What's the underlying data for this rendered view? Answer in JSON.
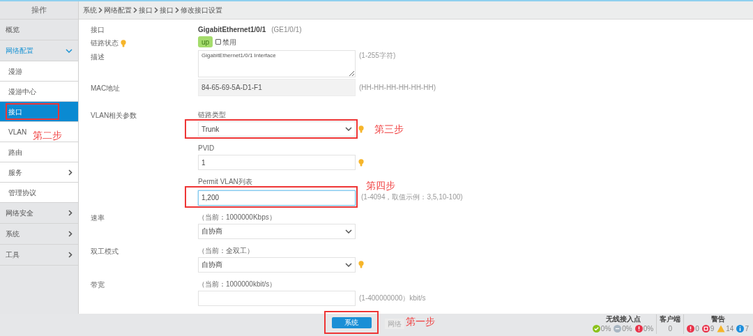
{
  "sidebar": {
    "header": "操作",
    "items": [
      {
        "label": "概览",
        "kind": "top",
        "expanded": false,
        "selected": false
      },
      {
        "label": "网络配置",
        "kind": "parent",
        "expanded": true,
        "selected": false,
        "children": [
          {
            "label": "漫游",
            "selected": false
          },
          {
            "label": "漫游中心",
            "selected": false
          },
          {
            "label": "接口",
            "selected": true,
            "annotation": "第二步"
          },
          {
            "label": "VLAN",
            "selected": false
          },
          {
            "label": "路由",
            "selected": false
          },
          {
            "label": "服务",
            "selected": false,
            "has_submenu": true
          },
          {
            "label": "管理协议",
            "selected": false
          }
        ]
      },
      {
        "label": "网络安全",
        "kind": "parent",
        "expanded": false,
        "selected": false
      },
      {
        "label": "系统",
        "kind": "parent",
        "expanded": false,
        "selected": false
      },
      {
        "label": "工具",
        "kind": "parent",
        "expanded": false,
        "selected": false
      }
    ]
  },
  "breadcrumb": [
    "系统",
    "网络配置",
    "接口",
    "接口",
    "修改接口设置"
  ],
  "form": [
    {
      "label": "接口",
      "kind": "text",
      "value": "GigabitEthernet1/0/1",
      "note": "(GE1/0/1)"
    },
    {
      "label": "链路状态",
      "kind": "status",
      "tip": true,
      "badge": "up",
      "checkbox": {
        "label": "禁用",
        "checked": false
      }
    },
    {
      "label": "描述",
      "kind": "textarea",
      "value": "GigabitEthernet1/0/1 Interface",
      "note": "(1-255字符)"
    },
    {
      "label": "MAC地址",
      "kind": "readonly",
      "value": "84-65-69-5A-D1-F1",
      "note": "(HH-HH-HH-HH-HH-HH)"
    },
    {
      "label": "VLAN相关参数",
      "kind": "group",
      "items": [
        {
          "caption": "链路类型",
          "kind": "select",
          "value": "Trunk",
          "tip": true,
          "annotation": "第三步"
        },
        {
          "caption": "PVID",
          "kind": "input",
          "value": "1",
          "tip": true
        },
        {
          "caption": "Permit VLAN列表",
          "kind": "input",
          "value": "1,200",
          "focused": true,
          "note": "(1-4094，取值示例：3,5,10-100)",
          "annotation": "第四步"
        }
      ]
    },
    {
      "label": "速率",
      "kind": "group",
      "items": [
        {
          "caption": "（当前：1000000Kbps）",
          "kind": "select",
          "value": "自协商"
        }
      ]
    },
    {
      "label": "双工模式",
      "kind": "group",
      "items": [
        {
          "caption": "（当前：全双工）",
          "kind": "select",
          "value": "自协商",
          "tip": true
        }
      ]
    },
    {
      "label": "带宽",
      "kind": "group",
      "items": [
        {
          "caption": "（当前：1000000kbit/s）",
          "kind": "input",
          "note": "(1-400000000）kbit/s"
        }
      ]
    }
  ],
  "footer": {
    "primary_button": {
      "label": "系统",
      "annotation": "第一步"
    },
    "secondary_button": {
      "label": "网络"
    }
  },
  "status": {
    "access_points": {
      "title": "无线接入点",
      "indicators": [
        {
          "kind": "ok",
          "value": "0%"
        },
        {
          "kind": "offline",
          "value": "0%"
        },
        {
          "kind": "error",
          "value": "0%"
        }
      ]
    },
    "clients": {
      "title": "客户端",
      "value": "0"
    },
    "alarms": {
      "title": "警告",
      "indicators": [
        {
          "kind": "error",
          "value": "0"
        },
        {
          "kind": "critical",
          "value": "9"
        },
        {
          "kind": "warning",
          "value": "14"
        },
        {
          "kind": "info",
          "value": "7"
        }
      ]
    }
  }
}
